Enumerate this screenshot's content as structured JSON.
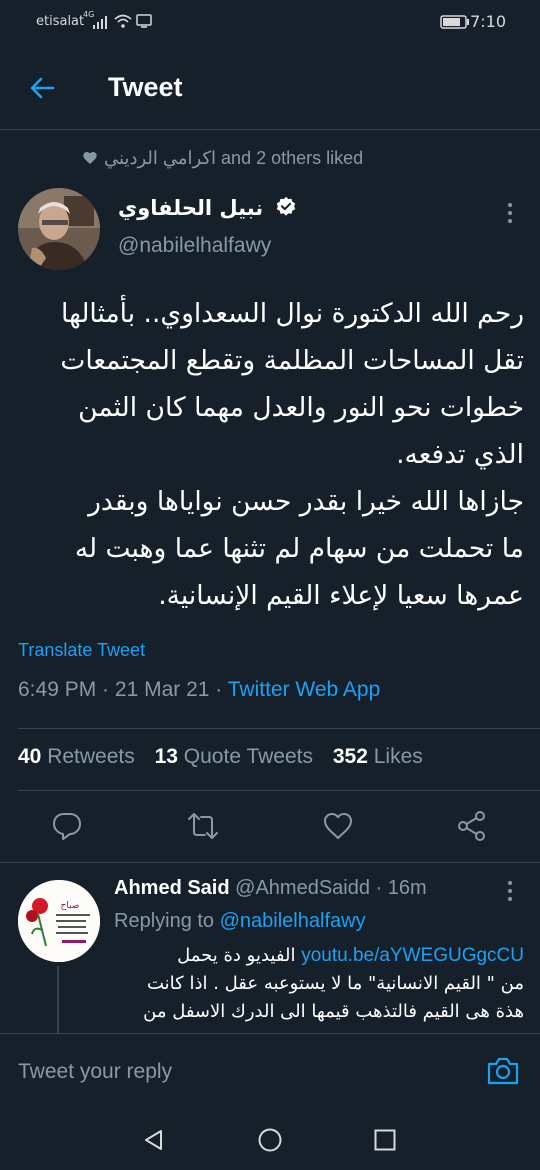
{
  "status_bar": {
    "carrier": "etisalat",
    "network": "4G",
    "time": "7:10"
  },
  "header": {
    "title": "Tweet"
  },
  "social_context": {
    "liker": "اكرامي الرديني",
    "text": "and 2 others liked"
  },
  "tweet": {
    "author_name": "نبيل الحلفاوي",
    "author_handle": "@nabilelhalfawy",
    "body": "رحم الله الدكتورة نوال السعداوي.. بأمثالها\nتقل المساحات المظلمة وتقطع المجتمعات\nخطوات نحو النور والعدل مهما كان الثمن\nالذي تدفعه.\nجازاها الله خيرا بقدر حسن نواياها وبقدر\nما تحملت من سهام لم تثنها عما وهبت له\nعمرها سعيا لإعلاء القيم الإنسانية.",
    "translate_label": "Translate Tweet",
    "time": "6:49 PM",
    "date": "21 Mar 21",
    "source": "Twitter Web App",
    "separator": " · "
  },
  "stats": {
    "retweets_count": "40",
    "retweets_label": "Retweets",
    "quotes_count": "13",
    "quotes_label": "Quote Tweets",
    "likes_count": "352",
    "likes_label": "Likes"
  },
  "actions": {
    "icons": [
      "reply-icon",
      "retweet-icon",
      "like-icon",
      "share-icon"
    ]
  },
  "reply": {
    "author_name": "Ahmed Said",
    "author_handle": "@AhmedSaidd",
    "age": "· 16m",
    "replying_label": "Replying to",
    "replying_handle": "@nabilelhalfawy",
    "link": "youtu.be/aYWEGUGgcCU",
    "body_line1": "الفيديو دة يحمل",
    "body_rest": "من \" القيم الانسانية\" ما لا يستوعبه عقل . اذا كانت\nهذة هى القيم فالتذهب قيمها الى الدرك الاسفل من"
  },
  "compose": {
    "placeholder": "Tweet your reply"
  },
  "colors": {
    "background": "#15202b",
    "accent": "#1da1f2",
    "muted": "#8899a6",
    "divider": "#38444d"
  }
}
